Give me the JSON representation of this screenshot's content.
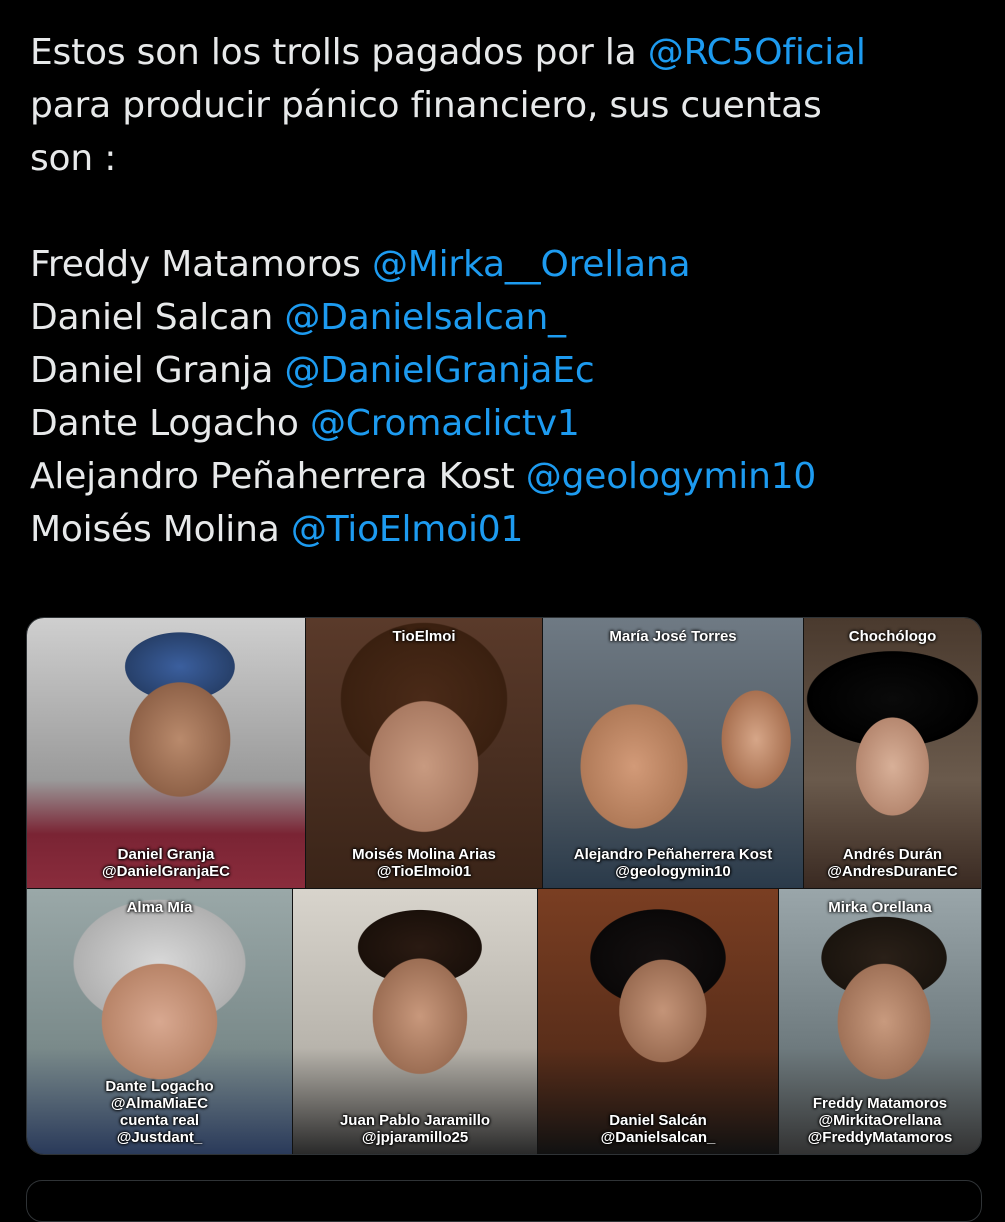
{
  "tweet": {
    "intro_1": "Estos son los trolls pagados por la ",
    "intro_mention": "@RC5Oficial",
    "intro_2": "para producir pánico financiero, sus cuentas",
    "intro_3": "son :",
    "accounts": [
      {
        "name": "Freddy Matamoros ",
        "handle": "@Mirka__Orellana"
      },
      {
        "name": "Daniel Salcan ",
        "handle": "@Danielsalcan_"
      },
      {
        "name": "Daniel Granja ",
        "handle": "@DanielGranjaEc"
      },
      {
        "name": "Dante Logacho ",
        "handle": "@Cromaclictv1"
      },
      {
        "name": "Alejandro Peñaherrera Kost ",
        "handle": "@geologymin10"
      },
      {
        "name": "Moisés Molina ",
        "handle": "@TioElmoi01"
      }
    ]
  },
  "media": {
    "cells": [
      {
        "top": "",
        "bottom": [
          "Daniel Granja",
          "@DanielGranjaEC"
        ]
      },
      {
        "top": "TioElmoi",
        "bottom": [
          "Moisés Molina Arias",
          "@TioElmoi01"
        ]
      },
      {
        "top": "María José Torres",
        "bottom": [
          "Alejandro Peñaherrera Kost",
          "@geologymin10"
        ]
      },
      {
        "top": "Chochólogo",
        "bottom": [
          "Andrés Durán",
          "@AndresDuranEC"
        ]
      },
      {
        "top": "Alma Mía",
        "bottom": [
          "Dante Logacho",
          "@AlmaMiaEC",
          "cuenta real",
          "@Justdant_"
        ]
      },
      {
        "top": "",
        "bottom": [
          "Juan Pablo Jaramillo",
          "@jpjaramillo25"
        ]
      },
      {
        "top": "",
        "bottom": [
          "Daniel Salcán",
          "@Danielsalcan_"
        ]
      },
      {
        "top": "Mirka Orellana",
        "bottom": [
          "Freddy Matamoros",
          "@MirkitaOrellana",
          "@FreddyMatamoros"
        ]
      }
    ]
  },
  "colors": {
    "background": "#000000",
    "text": "#e7e9ea",
    "mention": "#1d9bf0",
    "border": "#2f3336"
  }
}
